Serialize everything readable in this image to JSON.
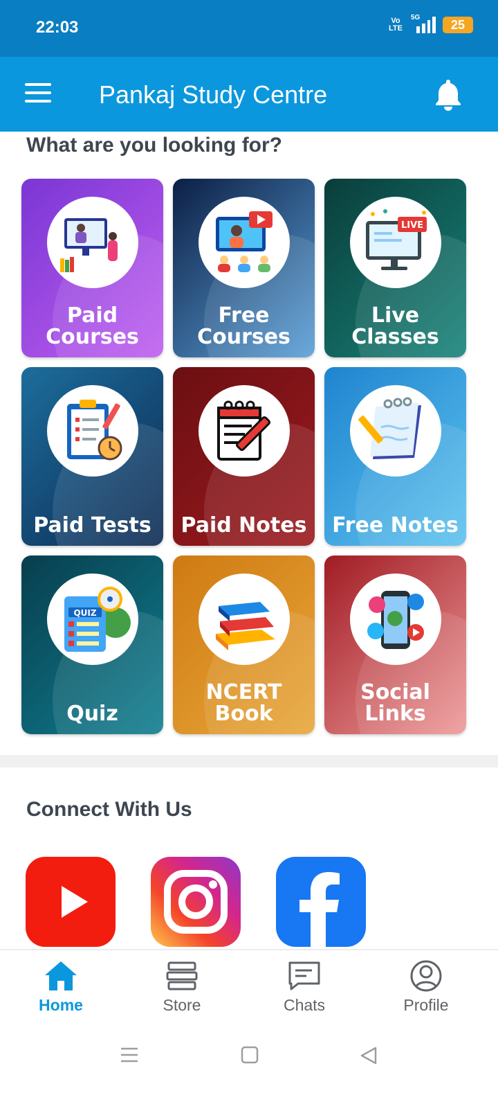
{
  "status": {
    "time": "22:03",
    "network": "5G",
    "volte_top": "Vo",
    "volte_bottom": "LTE",
    "battery": "25"
  },
  "appbar": {
    "title": "Pankaj Study Centre",
    "menu_icon": "hamburger-menu-icon",
    "bell_icon": "bell-icon"
  },
  "section_title": "What are you looking for?",
  "tiles": [
    {
      "label": "Paid\nCourses",
      "icon": "online-teaching-icon",
      "color_a": "#7a36d4",
      "color_b": "#c05ff0"
    },
    {
      "label": "Free\nCourses",
      "icon": "video-class-icon",
      "color_a": "#0c1f45",
      "color_b": "#5aa0d8"
    },
    {
      "label": "Live\nClasses",
      "icon": "live-monitor-icon",
      "color_a": "#0a3d3a",
      "color_b": "#17847a"
    },
    {
      "label": "Paid Tests",
      "icon": "test-clipboard-icon",
      "color_a": "#1c6d9c",
      "color_b": "#0d2a52"
    },
    {
      "label": "Paid Notes",
      "icon": "notepad-pencil-icon",
      "color_a": "#6b0f12",
      "color_b": "#9c1a1f"
    },
    {
      "label": "Free Notes",
      "icon": "spiral-notebook-icon",
      "color_a": "#1f84cf",
      "color_b": "#5ec3ef"
    },
    {
      "label": "Quiz",
      "icon": "quiz-icon",
      "color_a": "#083e4e",
      "color_b": "#0f7f90"
    },
    {
      "label": "NCERT Book",
      "icon": "books-stack-icon",
      "color_a": "#cf7a12",
      "color_b": "#e8a73a"
    },
    {
      "label": "Social Links",
      "icon": "social-phone-icon",
      "color_a": "#a01c24",
      "color_b": "#ef9a9a"
    }
  ],
  "connect_title": "Connect With Us",
  "social": [
    {
      "name": "youtube",
      "color": "#f21c0f"
    },
    {
      "name": "instagram",
      "color": "#e1306c"
    },
    {
      "name": "facebook",
      "color": "#1877f2"
    }
  ],
  "nav": [
    {
      "label": "Home",
      "icon": "home-icon",
      "active": true
    },
    {
      "label": "Store",
      "icon": "store-icon",
      "active": false
    },
    {
      "label": "Chats",
      "icon": "chat-icon",
      "active": false
    },
    {
      "label": "Profile",
      "icon": "profile-icon",
      "active": false
    }
  ],
  "colors": {
    "primary": "#0b97dd",
    "status": "#0a7ec2",
    "active_nav": "#0b97dd"
  }
}
